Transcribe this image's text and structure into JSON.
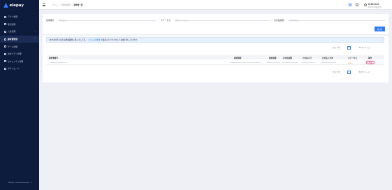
{
  "sidebar": {
    "logo_text": "elepay",
    "items": [
      {
        "label": "アプリ管理",
        "active": false
      },
      {
        "label": "取引管理",
        "active": false
      },
      {
        "label": "入金管理",
        "active": false,
        "chevron": "⌄"
      },
      {
        "label": "請求書管理",
        "active": true,
        "chevron": "⌃"
      },
      {
        "label": "ゲーム管理",
        "active": false
      },
      {
        "label": "決済プラン管理",
        "active": false
      },
      {
        "label": "セキュリティ管理",
        "active": false
      },
      {
        "label": "ダウンロード",
        "active": false
      }
    ],
    "footer_brand": "elepay",
    "footer_version": "v"
  },
  "header": {
    "breadcrumb": [
      "ホーム",
      "/",
      "請求書管理",
      "/",
      "請求書一覧"
    ],
    "user_name": "ELESTYLE",
    "user_sub": "ELESTYLE株式会社"
  },
  "filters": {
    "invoice_no_label": "請求番号：",
    "invoice_no_placeholder": "請求番号",
    "status_label": "ステータス：",
    "status_placeholder": "選択してください",
    "payment_date_label": "お支払期限：",
    "payment_date_placeholder": "日付を選択",
    "search_label": "検 索"
  },
  "notice": {
    "prefix": "2025年6月以前の請求書履歴に関しましては、",
    "link": "こちらの請求書",
    "suffix": "で確認いただけますようお願い申し上げます。"
  },
  "pager": {
    "total": "合計 1 件",
    "prev": "‹",
    "page": "1",
    "next": "›",
    "page_size": "50 件 / ページ"
  },
  "table": {
    "headers": [
      "請求書番号",
      "請求期間",
      "請求金額",
      "お支払期限",
      "お支払い日",
      "お支払い方法",
      "ステータス",
      "操作"
    ],
    "row": {
      "status": "未払い",
      "action": "詳細"
    }
  },
  "colors": {
    "sidebar_bg": "#0d1b3d",
    "accent": "#2f7bf6",
    "status": "#e6a23c",
    "action": "#e0457b"
  }
}
